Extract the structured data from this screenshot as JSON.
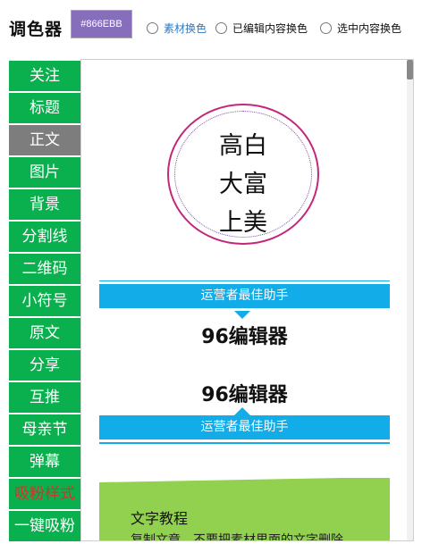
{
  "toolbar": {
    "title": "调色器",
    "color_value": "#866EBB",
    "options": [
      "素材换色",
      "已编辑内容换色",
      "选中内容换色"
    ]
  },
  "sidebar": {
    "items": [
      {
        "label": "关注"
      },
      {
        "label": "标题"
      },
      {
        "label": "正文",
        "state": "active"
      },
      {
        "label": "图片"
      },
      {
        "label": "背景"
      },
      {
        "label": "分割线"
      },
      {
        "label": "二维码"
      },
      {
        "label": "小符号"
      },
      {
        "label": "原文"
      },
      {
        "label": "分享"
      },
      {
        "label": "互推"
      },
      {
        "label": "母亲节"
      },
      {
        "label": "弹幕"
      },
      {
        "label": "吸粉样式",
        "text_color": "#d9302a"
      },
      {
        "label": "一键吸粉"
      }
    ]
  },
  "content": {
    "circle_lines": [
      "高白",
      "大富",
      "上美"
    ],
    "banner_text": "运营者最佳助手",
    "headline": "96编辑器",
    "card_title": "文字教程",
    "card_text": "复制文章，不要把素材里面的文字删除"
  },
  "colors": {
    "sidebar_bg": "#0ab04e",
    "sidebar_active_bg": "#7d7d7d",
    "banner_bg": "#12ace8",
    "circle_border": "#c4277a",
    "card_bg": "#92d050"
  }
}
